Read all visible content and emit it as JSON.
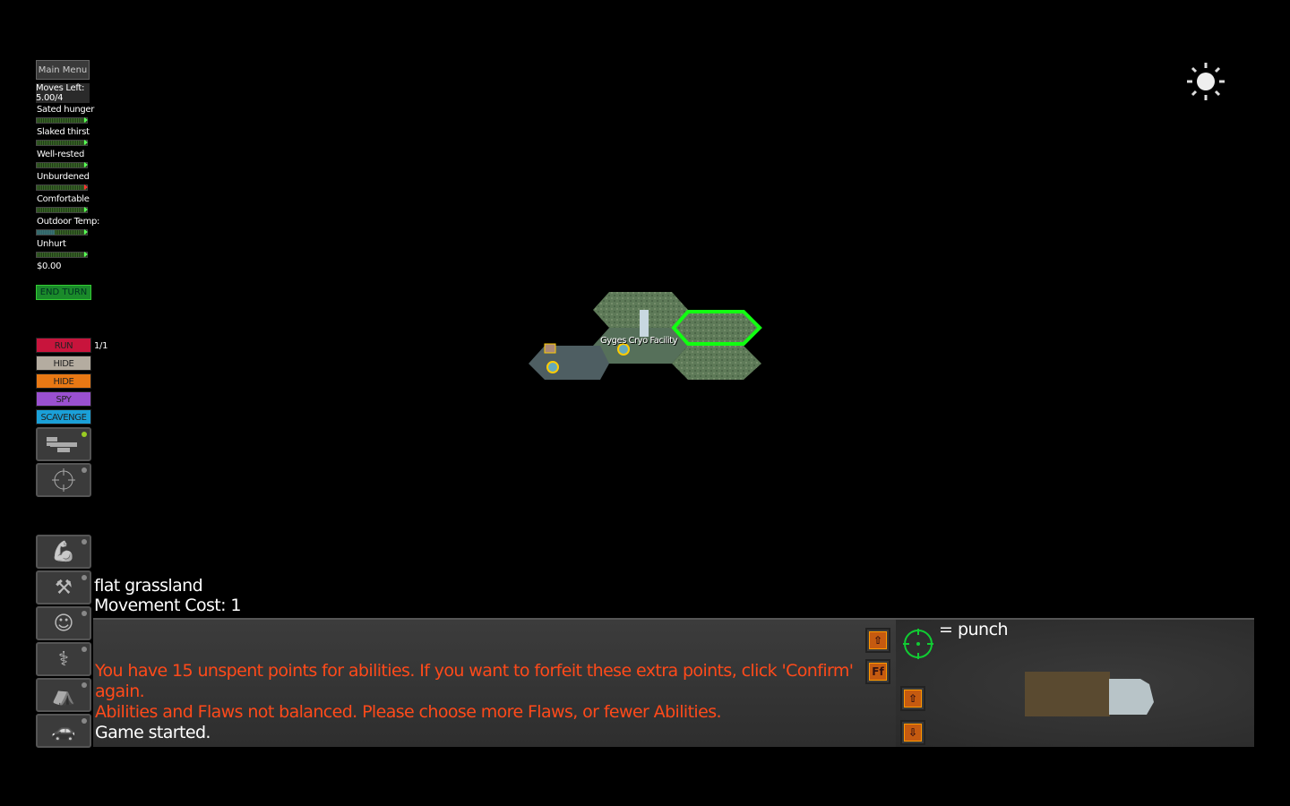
{
  "sidebar": {
    "main_menu": "Main Menu",
    "moves_label": "Moves Left:",
    "moves_value": "5.00/4",
    "stats": [
      {
        "label": "Sated hunger",
        "level": 0.95,
        "arrow": "#55ff55"
      },
      {
        "label": "Slaked thirst",
        "level": 0.95,
        "arrow": "#55ff55"
      },
      {
        "label": "Well-rested",
        "level": 0.95,
        "arrow": "#55ff55"
      },
      {
        "label": "Unburdened",
        "level": 0.95,
        "arrow": "#ff3030"
      },
      {
        "label": "Comfortable",
        "level": 0.95,
        "arrow": "#55ff55"
      },
      {
        "label": "Outdoor Temp:",
        "level": 0.35,
        "arrow": "#55ff55"
      },
      {
        "label": "Unhurt",
        "level": 0.95,
        "arrow": "#55ff55"
      }
    ],
    "money": "$0.00",
    "end_turn": "END TURN",
    "actions": [
      {
        "label": "RUN",
        "color": "#c8143c"
      },
      {
        "label": "HIDE",
        "color": "#b4aca0"
      },
      {
        "label": "HIDE TRACKS",
        "color": "#e87814"
      },
      {
        "label": "SPY",
        "color": "#9a50d0"
      },
      {
        "label": "SCAVENGE",
        "color": "#1aa0d8"
      }
    ],
    "run_count": "1/1",
    "tool_icons": [
      "hex-map-icon",
      "crosshair-icon"
    ],
    "skill_icons": [
      "strength-icon",
      "tools-icon",
      "person-icon",
      "medical-icon",
      "tent-icon",
      "car-icon"
    ]
  },
  "map": {
    "location_label": "Gyges Cryo Facility"
  },
  "terrain": {
    "name": "flat grassland",
    "movement_cost": "Movement Cost: 1"
  },
  "messages": [
    {
      "text": "You have 15 unspent points for abilities. If you want to forfeit these extra points, click 'Confirm' again.",
      "color": "#ff4a1a"
    },
    {
      "text": "Abilities and Flaws not balanced. Please choose more Flaws, or fewer Abilities.",
      "color": "#ff4a1a"
    },
    {
      "text": "Game started.",
      "color": "#ffffff"
    }
  ],
  "attack": {
    "label": "= punch"
  },
  "log_buttons": {
    "up": "⇧",
    "font": "Ff",
    "down": "⇩"
  }
}
